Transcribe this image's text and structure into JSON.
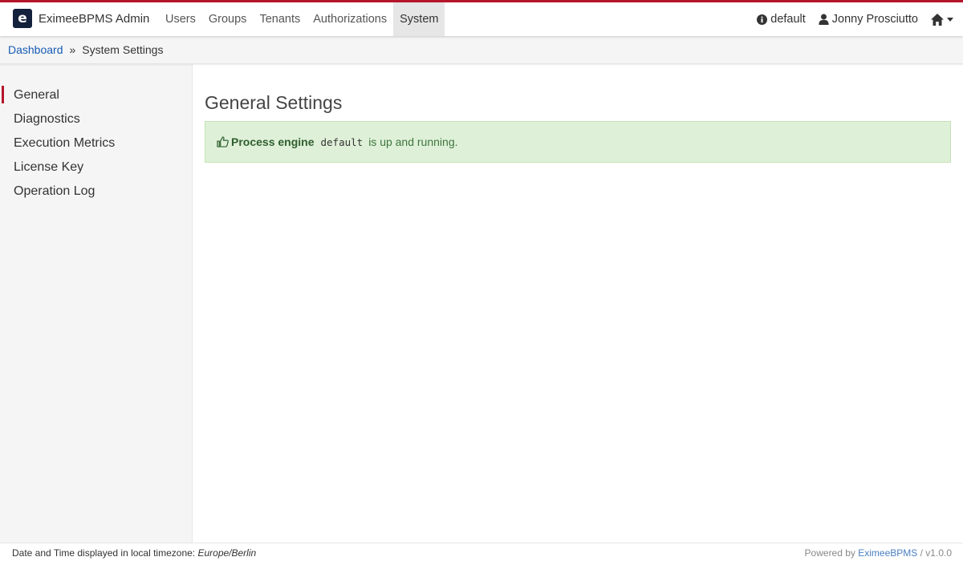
{
  "header": {
    "brand_letter": "e",
    "brand_name": "EximeeBPMS Admin",
    "nav": [
      "Users",
      "Groups",
      "Tenants",
      "Authorizations",
      "System"
    ],
    "active_nav": "System",
    "engine_label": "default",
    "user_label": "Jonny Prosciutto",
    "accent_color": "#b5152b"
  },
  "breadcrumb": {
    "home": "Dashboard",
    "separator": "»",
    "current": "System Settings"
  },
  "sidebar": {
    "items": [
      "General",
      "Diagnostics",
      "Execution Metrics",
      "License Key",
      "Operation Log"
    ],
    "active": "General"
  },
  "main": {
    "title": "General Settings",
    "alert": {
      "strong": "Process engine",
      "code": "default",
      "text": "is up and running."
    }
  },
  "footer": {
    "timezone_prefix": "Date and Time displayed in local timezone:",
    "timezone": "Europe/Berlin",
    "powered_prefix": "Powered by",
    "powered_link": "EximeeBPMS",
    "version": "/ v1.0.0"
  }
}
